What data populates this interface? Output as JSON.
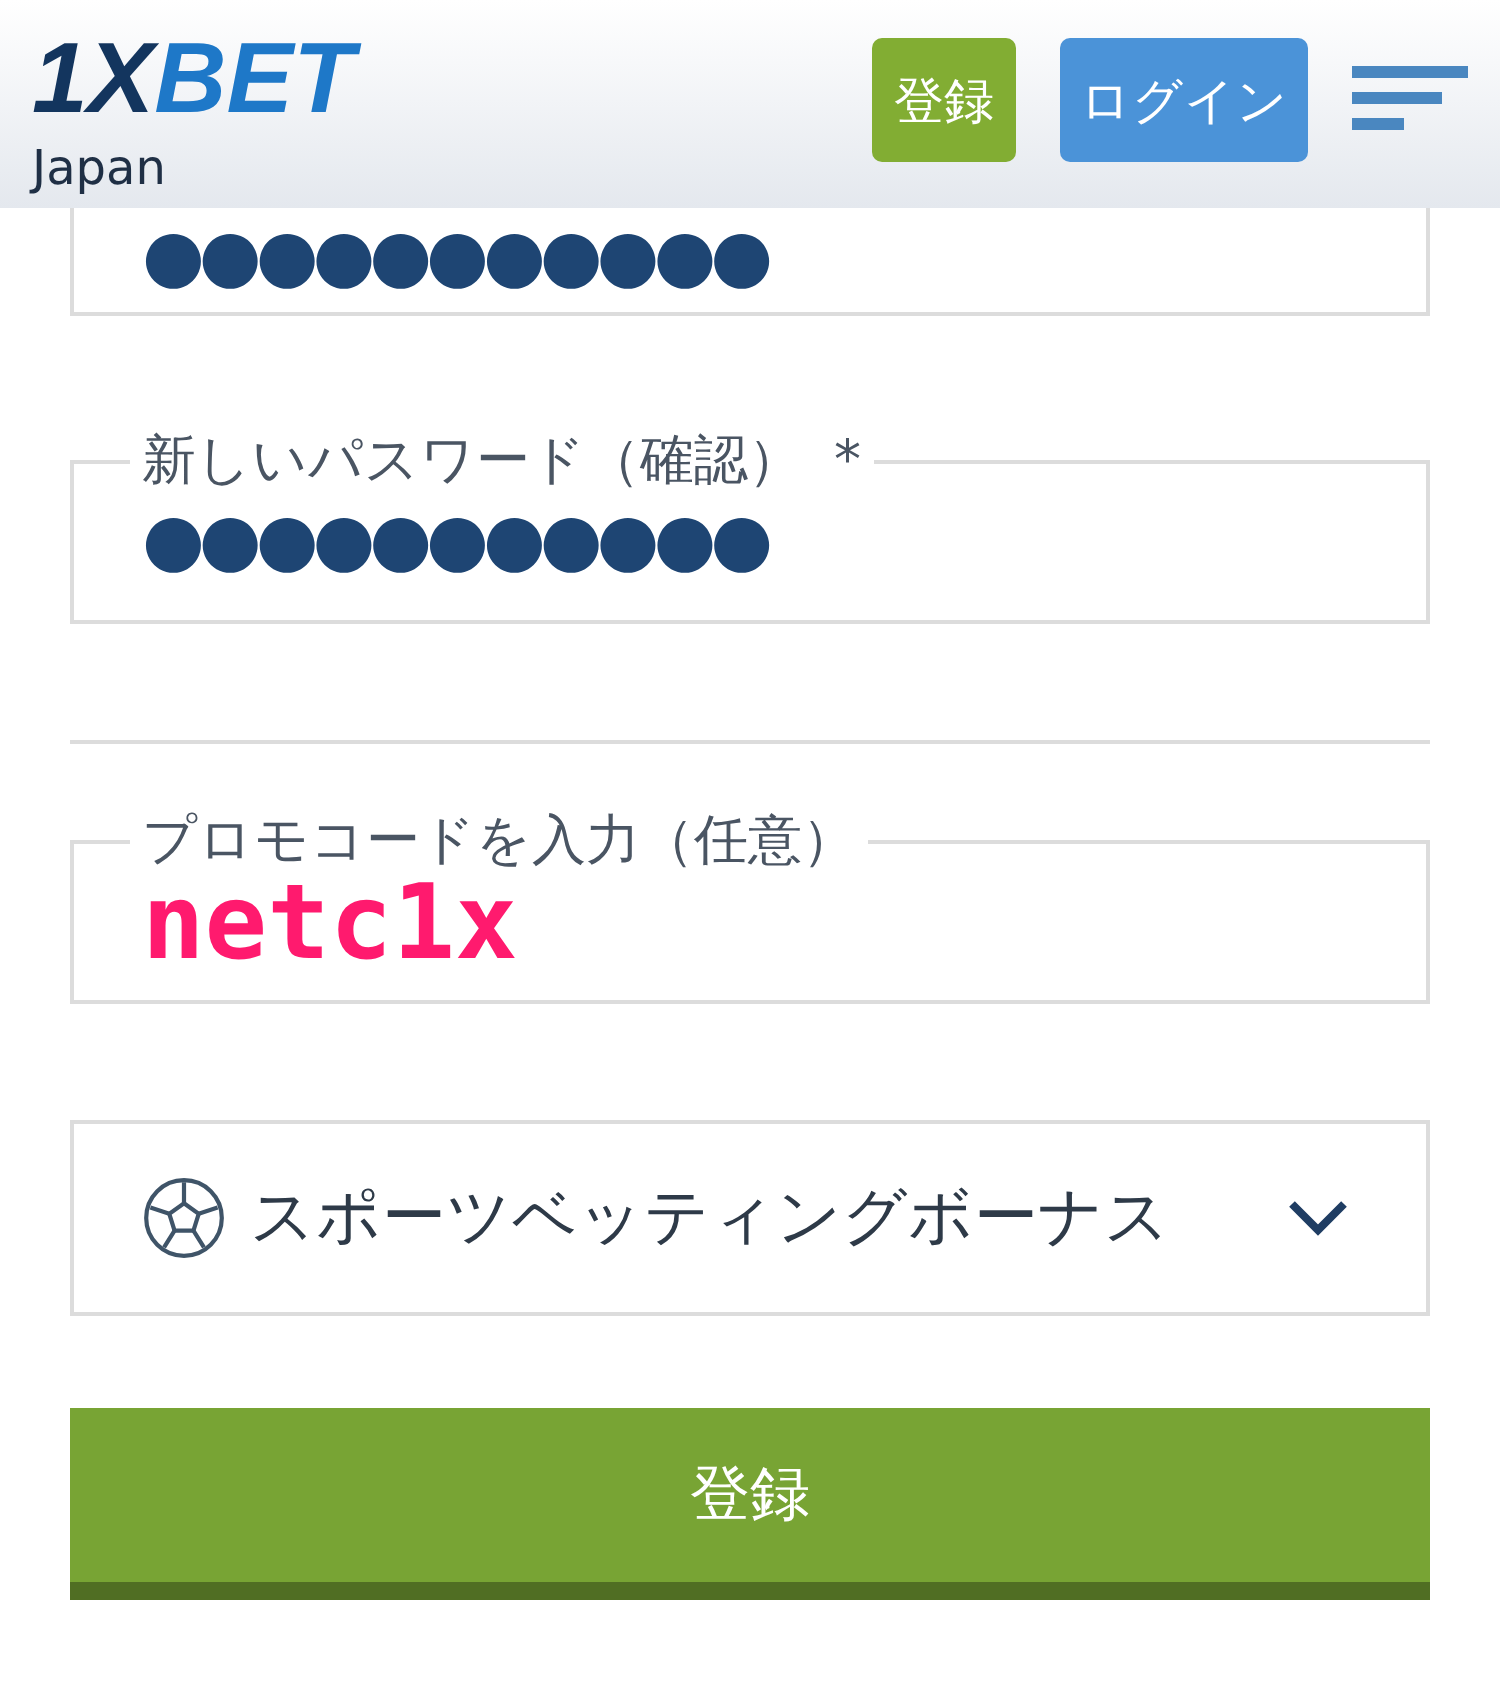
{
  "header": {
    "logo": {
      "part_1": "1X",
      "part_2": "BET"
    },
    "region": "Japan",
    "register_button": "登録",
    "login_button": "ログイン"
  },
  "fields": [
    {
      "kind": "password",
      "value": "●●●●●●●●●●●"
    },
    {
      "kind": "password",
      "label": "新しいパスワード（確認）",
      "required_mark": "*",
      "value": "●●●●●●●●●●●"
    },
    {
      "kind": "divider"
    },
    {
      "kind": "promo",
      "label": "プロモコードを入力（任意）",
      "value": "netc1x"
    },
    {
      "kind": "select",
      "value": "スポーツベッティングボーナス"
    }
  ],
  "submit_button": "登録"
}
